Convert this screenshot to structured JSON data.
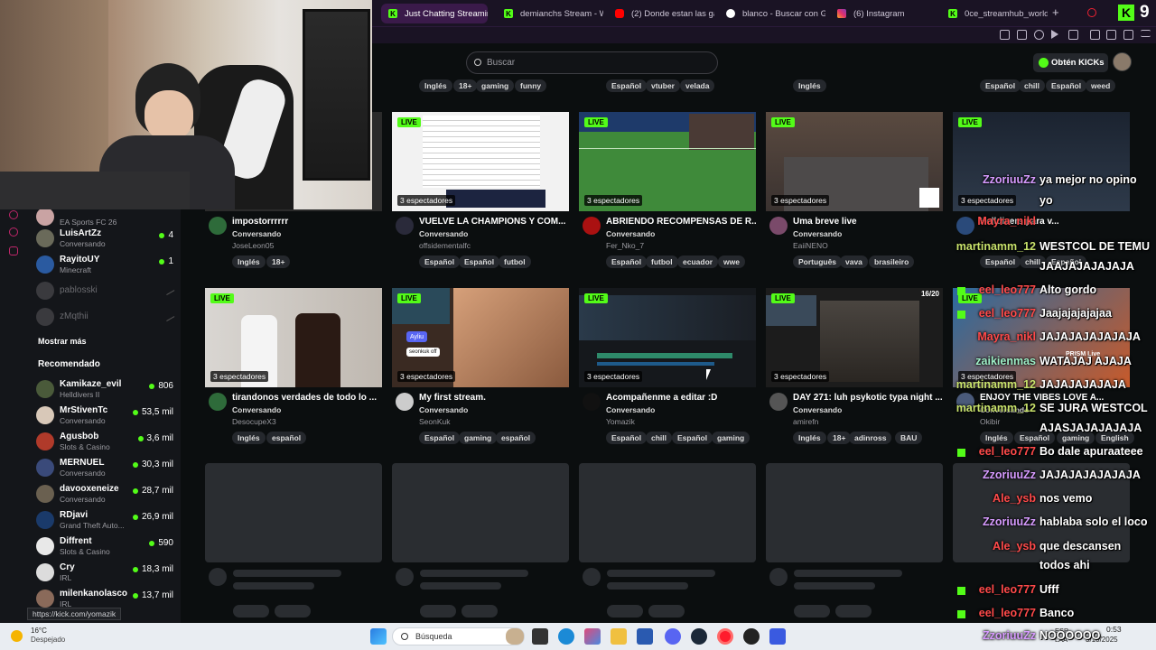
{
  "browser": {
    "tabs": [
      {
        "label": "Just Chatting Streaming",
        "icon": "kick-icon",
        "active": true
      },
      {
        "label": "demianchs Stream - Wa",
        "icon": "kick-icon"
      },
      {
        "label": "(2) Donde estan las gat",
        "icon": "youtube-icon"
      },
      {
        "label": "blanco - Buscar con Go",
        "icon": "google-icon"
      },
      {
        "label": "(6) Instagram",
        "icon": "instagram-icon"
      },
      {
        "label": "0ce_streamhub_world S",
        "icon": "kick-icon"
      }
    ],
    "new_tab": "+",
    "status_url": "https://kick.com/yomazik"
  },
  "kick": {
    "search_placeholder": "Buscar",
    "kicks_button": "Obtén KICKs",
    "logo_badge": "9",
    "accent": "#53fc18"
  },
  "sidebar": {
    "following": [
      {
        "name": "",
        "sub": "EA Sports FC 26",
        "count": ""
      },
      {
        "name": "LuisArtZz",
        "sub": "Conversando",
        "count": "4"
      },
      {
        "name": "RayitoUY",
        "sub": "Minecraft",
        "count": "1"
      },
      {
        "name": "pablosski",
        "sub": "",
        "count": "",
        "offline": true
      },
      {
        "name": "zMqthii",
        "sub": "",
        "count": "",
        "offline": true
      }
    ],
    "show_more": "Mostrar más",
    "recommended_title": "Recomendado",
    "recommended": [
      {
        "name": "Kamikaze_evil",
        "sub": "Helldivers II",
        "count": "806"
      },
      {
        "name": "MrStivenTc",
        "sub": "Conversando",
        "count": "53,5 mil"
      },
      {
        "name": "Agusbob",
        "sub": "Slots & Casino",
        "count": "3,6 mil"
      },
      {
        "name": "MERNUEL",
        "sub": "Conversando",
        "count": "30,3 mil"
      },
      {
        "name": "davooxeneize",
        "sub": "Conversando",
        "count": "28,7 mil"
      },
      {
        "name": "RDjavi",
        "sub": "Grand Theft Auto...",
        "count": "26,9 mil"
      },
      {
        "name": "Diffrent",
        "sub": "Slots & Casino",
        "count": "590"
      },
      {
        "name": "Cry",
        "sub": "IRL",
        "count": "18,3 mil"
      },
      {
        "name": "milenkanolasco",
        "sub": "IRL",
        "count": "13,7 mil"
      }
    ]
  },
  "top_tags": [
    [
      "Inglés",
      "18+",
      "gaming",
      "funny"
    ],
    [
      "Español",
      "vtuber",
      "velada"
    ],
    [
      "Inglés"
    ],
    [
      "Español",
      "chill",
      "Español",
      "weed"
    ]
  ],
  "live_label": "LIVE",
  "rows": [
    [
      {
        "title": "impostorrrrrr",
        "category": "Conversando",
        "user": "JoseLeon05",
        "viewers": "",
        "tags": [
          "Inglés",
          "18+"
        ]
      },
      {
        "title": "VUELVE LA CHAMPIONS Y COM...",
        "category": "Conversando",
        "user": "offsidementalfc",
        "viewers": "3 espectadores",
        "tags": [
          "Español",
          "Español",
          "futbol"
        ]
      },
      {
        "title": "ABRIENDO RECOMPENSAS DE R...",
        "category": "Conversando",
        "user": "Fer_Nko_7",
        "viewers": "3 espectadores",
        "tags": [
          "Español",
          "futbol",
          "ecuador",
          "wwe"
        ]
      },
      {
        "title": "Uma breve live",
        "category": "Conversando",
        "user": "EaiiNENO",
        "viewers": "3 espectadores",
        "tags": [
          "Português",
          "vava",
          "brasileiro"
        ]
      },
      {
        "title": "Helldivers para v...",
        "category": "Conversando",
        "user": "",
        "viewers": "3 espectadores",
        "tags": [
          "Español",
          "chill",
          "Español"
        ]
      }
    ],
    [
      {
        "title": "tirandonos verdades de todo lo ...",
        "category": "Conversando",
        "user": "DesocupeX3",
        "viewers": "3 espectadores",
        "tags": [
          "Inglés",
          "español"
        ]
      },
      {
        "title": "My first stream.",
        "category": "Conversando",
        "user": "SeonKuk",
        "viewers": "3 espectadores",
        "tags": [
          "Español",
          "gaming",
          "español"
        ]
      },
      {
        "title": "Acompañenme a editar :D",
        "category": "Conversando",
        "user": "Yomazik",
        "viewers": "3 espectadores",
        "tags": [
          "Español",
          "chill",
          "Español",
          "gaming"
        ]
      },
      {
        "title": "DAY 271: luh psykotic typa night ...",
        "category": "Conversando",
        "user": "amirefn",
        "viewers": "3 espectadores",
        "tags": [
          "Inglés",
          "18+",
          "adinross",
          "BAU"
        ]
      },
      {
        "title": "ENJOY THE VIBES LOVE A...",
        "category": "Conversando",
        "user": "Okibir",
        "viewers": "3 espectadores",
        "tags": [
          "Inglés",
          "Español",
          "gaming",
          "English"
        ]
      }
    ]
  ],
  "thumb_overlays": {
    "discord_label": "Ayliu",
    "seonkuk_label": "seonkuk off",
    "counter_label": "16/20",
    "prism_label": "PRISM Live"
  },
  "chat": [
    {
      "user": "ZzoriuuZz",
      "msg": "ya mejor no opino",
      "color": "#d79bff"
    },
    {
      "user": "",
      "msg": "yo",
      "color": "#d79bff"
    },
    {
      "user": "Mayra_nikl",
      "msg": "",
      "color": "#ff4a4a"
    },
    {
      "user": "martinamm_12",
      "msg": "WESTCOL DE TEMU",
      "color": "#c9e36c"
    },
    {
      "user": "",
      "msg": "JAAJAJAJAJAJA",
      "color": "#c9e36c"
    },
    {
      "user": "eel_leo777",
      "msg": "Alto gordo",
      "color": "#ff4a4a"
    },
    {
      "user": "eel_leo777",
      "msg": "Jaajajajajajaa",
      "color": "#ff4a4a"
    },
    {
      "user": "Mayra_nikl",
      "msg": "JAJAJAJAJAJAJA",
      "color": "#ff4a4a"
    },
    {
      "user": "zaikienmas",
      "msg": "WATAJAJ AJAJA",
      "color": "#9ff0c8"
    },
    {
      "user": "martinamm_12",
      "msg": "JAJAJAJAJAJA",
      "color": "#c9e36c"
    },
    {
      "user": "martinamm_12",
      "msg": "SE JURA WESTCOL",
      "color": "#c9e36c"
    },
    {
      "user": "",
      "msg": "AJASJAJAJAJAJA",
      "color": "#c9e36c"
    },
    {
      "user": "eel_leo777",
      "msg": "Bo dale apuraateee",
      "color": "#ff4a4a"
    },
    {
      "user": "ZzoriuuZz",
      "msg": "JAJAJAJAJAJAJA",
      "color": "#d79bff"
    },
    {
      "user": "Ale_ysb",
      "msg": "nos vemo",
      "color": "#ff4a4a"
    },
    {
      "user": "ZzoriuuZz",
      "msg": "hablaba solo el loco",
      "color": "#d79bff"
    },
    {
      "user": "Ale_ysb",
      "msg": "que descansen",
      "color": "#ff4a4a"
    },
    {
      "user": "",
      "msg": "todos ahi",
      "color": "#ff4a4a"
    },
    {
      "user": "eel_leo777",
      "msg": "Ufff",
      "color": "#ff4a4a"
    },
    {
      "user": "eel_leo777",
      "msg": "Banco",
      "color": "#ff4a4a"
    },
    {
      "user": "ZzoriuuZz",
      "msg": "NOOOOOO",
      "color": "#d79bff"
    }
  ],
  "taskbar": {
    "temp": "16°C",
    "weather": "Despejado",
    "search_placeholder": "Búsqueda",
    "lang": "ESP",
    "lang2": "LAA",
    "time": "0:53",
    "date": "3/10/2025"
  }
}
